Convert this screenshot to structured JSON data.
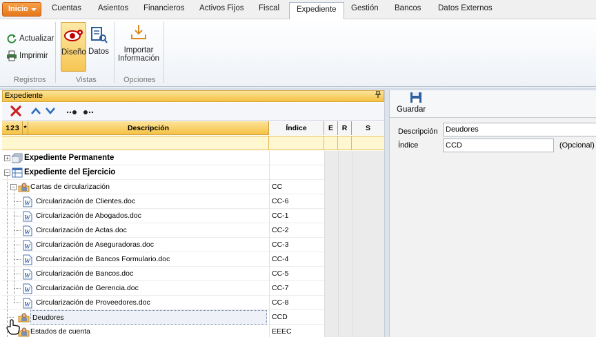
{
  "menubar": {
    "inicio": "Inicio",
    "tabs": [
      "Cuentas",
      "Asientos",
      "Financieros",
      "Activos Fijos",
      "Fiscal",
      "Expediente",
      "Gestión",
      "Bancos",
      "Datos Externos"
    ],
    "active_tab": "Expediente"
  },
  "ribbon": {
    "registros": {
      "actualizar": "Actualizar",
      "imprimir": "Imprimir",
      "label": "Registros"
    },
    "vistas": {
      "diseno": "Diseño",
      "datos": "Datos",
      "label": "Vistas"
    },
    "opciones": {
      "importar_line1": "Importar",
      "importar_line2": "Información",
      "label": "Opciones"
    }
  },
  "panel": {
    "title": "Expediente",
    "pin_icon": "pin-icon",
    "columns": {
      "levels": "1 2 3",
      "star": "*",
      "descripcion": "Descripción",
      "indice": "Índice",
      "e": "E",
      "r": "R",
      "s": "S"
    }
  },
  "rows": [
    {
      "desc": "Expediente Permanente",
      "idx": "",
      "level": 0,
      "bold": true
    },
    {
      "desc": "Expediente del Ejercicio",
      "idx": "",
      "level": 0,
      "bold": true
    },
    {
      "desc": "Cartas de circularización",
      "idx": "CC",
      "level": 1
    },
    {
      "desc": "Circularización de Clientes.doc",
      "idx": "CC-6",
      "level": 2
    },
    {
      "desc": "Circularización de Abogados.doc",
      "idx": "CC-1",
      "level": 2
    },
    {
      "desc": "Circularización de Actas.doc",
      "idx": "CC-2",
      "level": 2
    },
    {
      "desc": "Circularización de Aseguradoras.doc",
      "idx": "CC-3",
      "level": 2
    },
    {
      "desc": "Circularización de Bancos Formulario.doc",
      "idx": "CC-4",
      "level": 2
    },
    {
      "desc": "Circularización de Bancos.doc",
      "idx": "CC-5",
      "level": 2
    },
    {
      "desc": "Circularización de Gerencia.doc",
      "idx": "CC-7",
      "level": 2
    },
    {
      "desc": "Circularización de Proveedores.doc",
      "idx": "CC-8",
      "level": 2
    },
    {
      "desc": "Deudores",
      "idx": "CCD",
      "level": 1,
      "selected": true
    },
    {
      "desc": "Estados de cuenta",
      "idx": "EEEC",
      "level": 1
    }
  ],
  "form": {
    "guardar": "Guardar",
    "descripcion_label": "Descripción",
    "descripcion_value": "Deudores",
    "indice_label": "Índice",
    "indice_value": "CCD",
    "opcional": "(Opcional)"
  }
}
